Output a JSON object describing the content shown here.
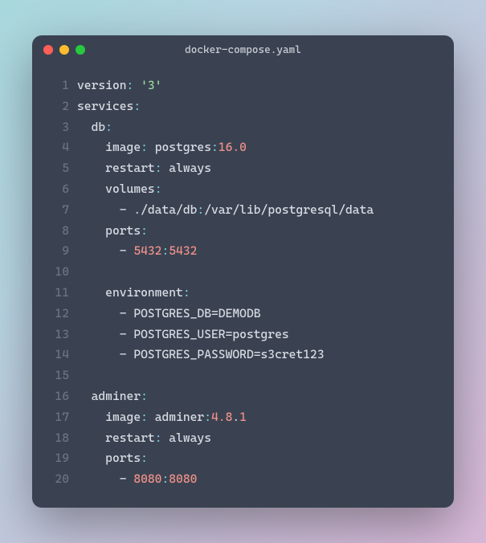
{
  "window": {
    "title": "docker-compose.yaml"
  },
  "code": {
    "lines": [
      {
        "n": "1",
        "tokens": [
          {
            "t": "version",
            "c": "key"
          },
          {
            "t": ":",
            "c": "colon"
          },
          {
            "t": " ",
            "c": "punc"
          },
          {
            "t": "'3'",
            "c": "str"
          }
        ]
      },
      {
        "n": "2",
        "tokens": [
          {
            "t": "services",
            "c": "key"
          },
          {
            "t": ":",
            "c": "colon"
          }
        ]
      },
      {
        "n": "3",
        "tokens": [
          {
            "t": "  ",
            "c": "punc"
          },
          {
            "t": "db",
            "c": "key"
          },
          {
            "t": ":",
            "c": "colon"
          }
        ]
      },
      {
        "n": "4",
        "tokens": [
          {
            "t": "    ",
            "c": "punc"
          },
          {
            "t": "image",
            "c": "key"
          },
          {
            "t": ":",
            "c": "colon"
          },
          {
            "t": " postgres",
            "c": "punc"
          },
          {
            "t": ":",
            "c": "colon"
          },
          {
            "t": "16.0",
            "c": "num"
          }
        ]
      },
      {
        "n": "5",
        "tokens": [
          {
            "t": "    ",
            "c": "punc"
          },
          {
            "t": "restart",
            "c": "key"
          },
          {
            "t": ":",
            "c": "colon"
          },
          {
            "t": " always",
            "c": "punc"
          }
        ]
      },
      {
        "n": "6",
        "tokens": [
          {
            "t": "    ",
            "c": "punc"
          },
          {
            "t": "volumes",
            "c": "key"
          },
          {
            "t": ":",
            "c": "colon"
          }
        ]
      },
      {
        "n": "7",
        "tokens": [
          {
            "t": "      - ./data/db",
            "c": "punc"
          },
          {
            "t": ":",
            "c": "colon"
          },
          {
            "t": "/var/lib/postgresql/data",
            "c": "punc"
          }
        ]
      },
      {
        "n": "8",
        "tokens": [
          {
            "t": "    ",
            "c": "punc"
          },
          {
            "t": "ports",
            "c": "key"
          },
          {
            "t": ":",
            "c": "colon"
          }
        ]
      },
      {
        "n": "9",
        "tokens": [
          {
            "t": "      - ",
            "c": "punc"
          },
          {
            "t": "5432",
            "c": "num"
          },
          {
            "t": ":",
            "c": "colon"
          },
          {
            "t": "5432",
            "c": "num"
          }
        ]
      },
      {
        "n": "10",
        "tokens": []
      },
      {
        "n": "11",
        "tokens": [
          {
            "t": "    ",
            "c": "punc"
          },
          {
            "t": "environment",
            "c": "key"
          },
          {
            "t": ":",
            "c": "colon"
          }
        ]
      },
      {
        "n": "12",
        "tokens": [
          {
            "t": "      - POSTGRES_DB=DEMODB",
            "c": "punc"
          }
        ]
      },
      {
        "n": "13",
        "tokens": [
          {
            "t": "      - POSTGRES_USER=postgres",
            "c": "punc"
          }
        ]
      },
      {
        "n": "14",
        "tokens": [
          {
            "t": "      - POSTGRES_PASSWORD=s3cret123",
            "c": "punc"
          }
        ]
      },
      {
        "n": "15",
        "tokens": []
      },
      {
        "n": "16",
        "tokens": [
          {
            "t": "  ",
            "c": "punc"
          },
          {
            "t": "adminer",
            "c": "key"
          },
          {
            "t": ":",
            "c": "colon"
          }
        ]
      },
      {
        "n": "17",
        "tokens": [
          {
            "t": "    ",
            "c": "punc"
          },
          {
            "t": "image",
            "c": "key"
          },
          {
            "t": ":",
            "c": "colon"
          },
          {
            "t": " adminer",
            "c": "punc"
          },
          {
            "t": ":",
            "c": "colon"
          },
          {
            "t": "4.8",
            "c": "num"
          },
          {
            "t": ".",
            "c": "punc"
          },
          {
            "t": "1",
            "c": "num"
          }
        ]
      },
      {
        "n": "18",
        "tokens": [
          {
            "t": "    ",
            "c": "punc"
          },
          {
            "t": "restart",
            "c": "key"
          },
          {
            "t": ":",
            "c": "colon"
          },
          {
            "t": " always",
            "c": "punc"
          }
        ]
      },
      {
        "n": "19",
        "tokens": [
          {
            "t": "    ",
            "c": "punc"
          },
          {
            "t": "ports",
            "c": "key"
          },
          {
            "t": ":",
            "c": "colon"
          }
        ]
      },
      {
        "n": "20",
        "tokens": [
          {
            "t": "      - ",
            "c": "punc"
          },
          {
            "t": "8080",
            "c": "num"
          },
          {
            "t": ":",
            "c": "colon"
          },
          {
            "t": "8080",
            "c": "num"
          }
        ]
      }
    ]
  }
}
